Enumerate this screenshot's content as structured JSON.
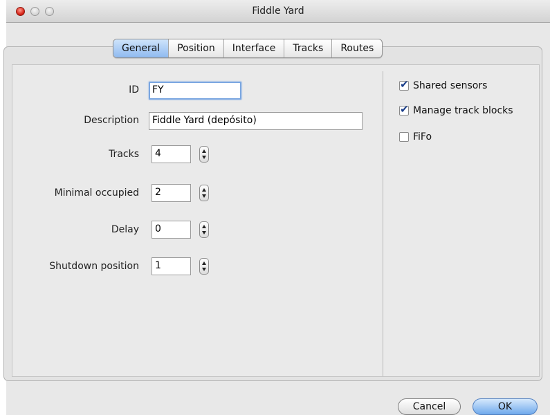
{
  "window": {
    "title": "Fiddle Yard"
  },
  "tabs": [
    {
      "label": "General",
      "active": true
    },
    {
      "label": "Position",
      "active": false
    },
    {
      "label": "Interface",
      "active": false
    },
    {
      "label": "Tracks",
      "active": false
    },
    {
      "label": "Routes",
      "active": false
    }
  ],
  "form": {
    "id": {
      "label": "ID",
      "value": "FY"
    },
    "description": {
      "label": "Description",
      "value": "Fiddle Yard (depósito)"
    },
    "tracks": {
      "label": "Tracks",
      "value": "4"
    },
    "minimal_occupied": {
      "label": "Minimal occupied",
      "value": "2"
    },
    "delay": {
      "label": "Delay",
      "value": "0"
    },
    "shutdown_position": {
      "label": "Shutdown position",
      "value": "1"
    }
  },
  "options": [
    {
      "label": "Shared sensors",
      "checked": true
    },
    {
      "label": "Manage track blocks",
      "checked": true
    },
    {
      "label": "FiFo",
      "checked": false
    }
  ],
  "buttons": {
    "cancel": "Cancel",
    "ok": "OK"
  },
  "colors": {
    "active_tab": "#8fbaf0",
    "default_button": "#6fa9ec",
    "close_light": "#d9281c"
  }
}
